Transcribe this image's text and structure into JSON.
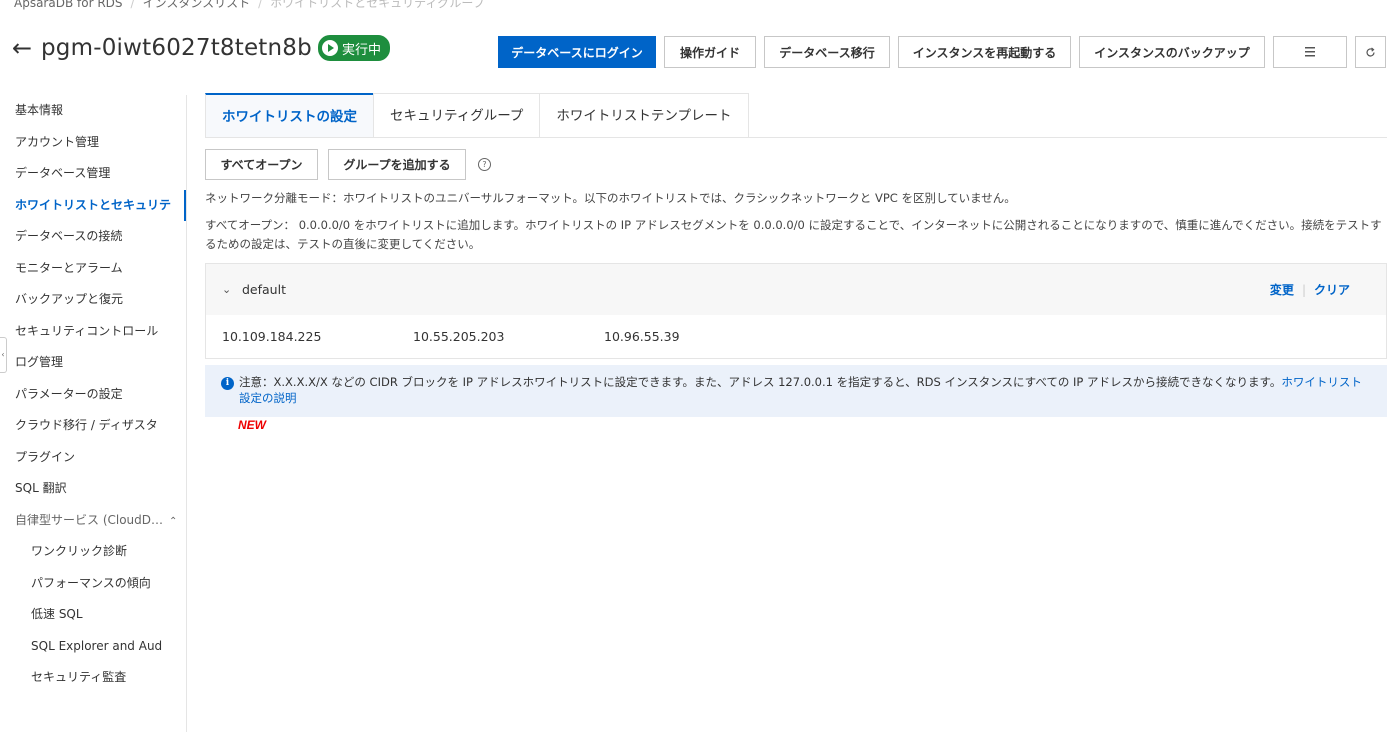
{
  "breadcrumb": {
    "items": [
      "ApsaraDB for RDS",
      "インスタンスリスト",
      "ホワイトリストとセキュリティグループ"
    ]
  },
  "header": {
    "title": "pgm-0iwt6027t8tetn8b",
    "status": "実行中",
    "status_color": "#1e8e3e"
  },
  "actions": {
    "login": "データベースにログイン",
    "guide": "操作ガイド",
    "migrate": "データベース移行",
    "restart": "インスタンスを再起動する",
    "backup": "インスタンスのバックアップ"
  },
  "sidebar": {
    "items": [
      "基本情報",
      "アカウント管理",
      "データベース管理",
      "ホワイトリストとセキュリテ",
      "データベースの接続",
      "モニターとアラーム",
      "バックアップと復元",
      "セキュリティコントロール",
      "ログ管理",
      "パラメーターの設定",
      "クラウド移行 / ディザスタ",
      "プラグイン",
      "SQL 翻訳"
    ],
    "group_label": "自律型サービス (CloudD…",
    "sub_items": [
      "ワンクリック診断",
      "パフォーマンスの傾向",
      "低速 SQL",
      "SQL Explorer and Aud",
      "セキュリティ監査"
    ]
  },
  "tabs": [
    "ホワイトリストの設定",
    "セキュリティグループ",
    "ホワイトリストテンプレート"
  ],
  "toolbar": {
    "open_all": "すべてオープン",
    "add_group": "グループを追加する"
  },
  "desc": {
    "network_mode": "ネットワーク分離モード：ホワイトリストのユニバーサルフォーマット。以下のホワイトリストでは、クラシックネットワークと VPC を区別していません。",
    "open_all_note": "すべてオープン： 0.0.0.0/0 をホワイトリストに追加します。ホワイトリストの IP アドレスセグメントを 0.0.0.0/0 に設定することで、インターネットに公開されることになりますので、慎重に進んでください。接続をテストするための設定は、テストの直後に変更してください。"
  },
  "group": {
    "name": "default",
    "edit": "変更",
    "clear": "クリア",
    "ips": [
      "10.109.184.225",
      "10.55.205.203",
      "10.96.55.39"
    ]
  },
  "notice": {
    "text": "注意：X.X.X.X/X などの CIDR ブロックを IP アドレスホワイトリストに設定できます。また、アドレス 127.0.0.1 を指定すると、RDS インスタンスにすべての IP アドレスから接続できなくなります。",
    "link": "ホワイトリスト設定の説明"
  },
  "new_badge": "NEW",
  "colors": {
    "primary": "#0064c8",
    "success": "#1e8e3e",
    "new": "#ee0000"
  }
}
